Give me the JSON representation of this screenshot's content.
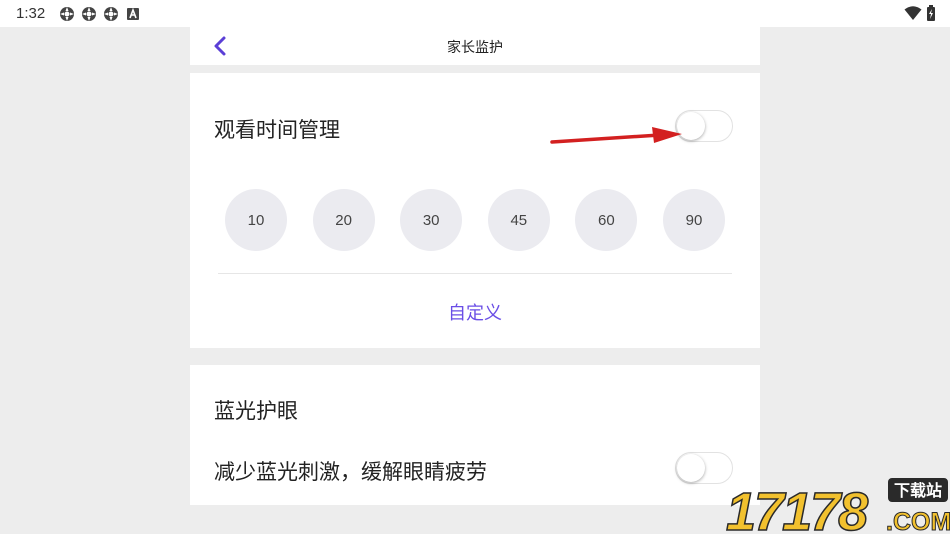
{
  "status_bar": {
    "time": "1:32",
    "icons": [
      "settings-icon",
      "settings-icon",
      "settings-icon",
      "font-icon"
    ],
    "right_icons": [
      "wifi-icon",
      "battery-icon"
    ]
  },
  "header": {
    "title": "家长监护",
    "back_icon": "chevron-left-icon"
  },
  "watch_time": {
    "label": "观看时间管理",
    "toggle_on": false,
    "options": [
      "10",
      "20",
      "30",
      "45",
      "60",
      "90"
    ],
    "custom_label": "自定义"
  },
  "blue_light": {
    "label": "蓝光护眼",
    "description": "减少蓝光刺激，缓解眼睛疲劳",
    "toggle_on": false
  },
  "watermark": {
    "brand": "17178",
    "suffix": ".COM",
    "tag": "下载站"
  },
  "colors": {
    "accent": "#6a4ee6",
    "background": "#ededed",
    "option_bg": "#ebebf0",
    "arrow": "#d32020"
  }
}
